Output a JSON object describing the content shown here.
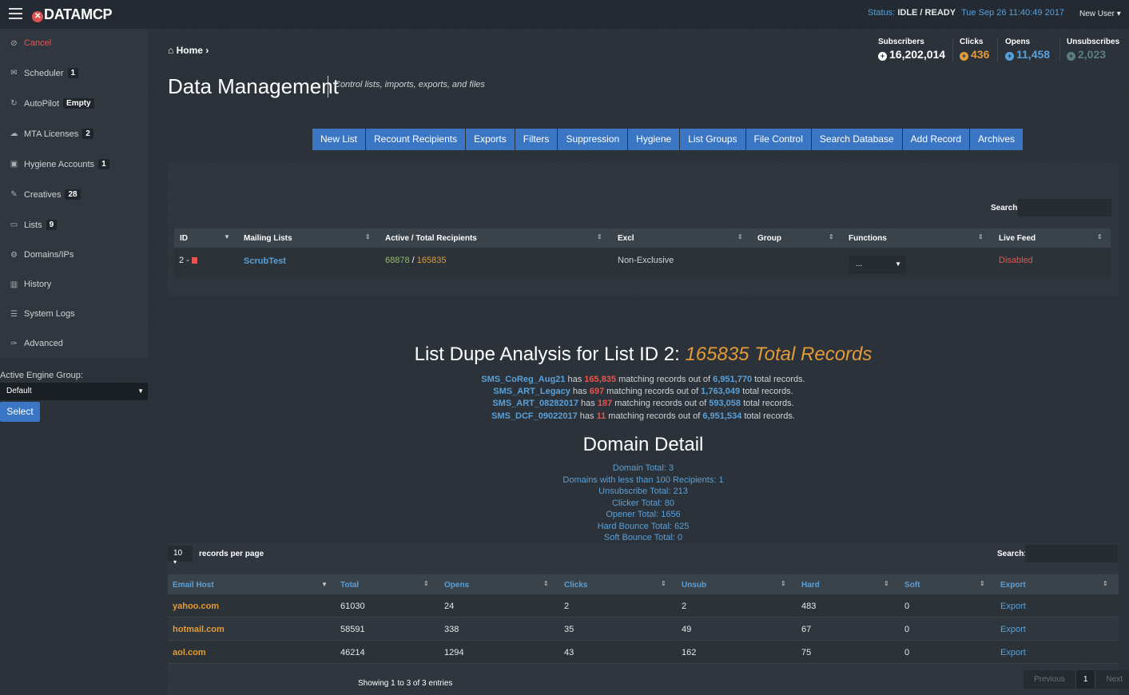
{
  "app": {
    "logo_prefix": "DATA",
    "logo_suffix": "MCP",
    "status_label": "Status:",
    "status_value": "IDLE / READY",
    "datetime": "Tue Sep 26 11:40:49 2017",
    "user_menu": "New User"
  },
  "sidebar": {
    "items": [
      {
        "label": "Cancel",
        "icon": "ban-icon",
        "badge": ""
      },
      {
        "label": "Scheduler",
        "icon": "envelope-icon",
        "badge": "1"
      },
      {
        "label": "AutoPilot",
        "icon": "refresh-icon",
        "badge": "Empty"
      },
      {
        "label": "MTA Licenses",
        "icon": "cloud-icon",
        "badge": "2"
      },
      {
        "label": "Hygiene Accounts",
        "icon": "briefcase-icon",
        "badge": "1"
      },
      {
        "label": "Creatives",
        "icon": "edit-icon",
        "badge": "28"
      },
      {
        "label": "Lists",
        "icon": "folder-icon",
        "badge": "9"
      },
      {
        "label": "Domains/IPs",
        "icon": "cogs-icon",
        "badge": ""
      },
      {
        "label": "History",
        "icon": "chart-icon",
        "badge": ""
      },
      {
        "label": "System Logs",
        "icon": "list-icon",
        "badge": ""
      },
      {
        "label": "Advanced",
        "icon": "wrench-icon",
        "badge": ""
      }
    ],
    "engine_group_label": "Active Engine Group:",
    "engine_group_value": "Default",
    "select_button": "Select"
  },
  "breadcrumb": {
    "home": "Home"
  },
  "stats": {
    "subscribers": {
      "label": "Subscribers",
      "value": "16,202,014",
      "color": "#ffffff"
    },
    "clicks": {
      "label": "Clicks",
      "value": "436",
      "color": "#e39a37"
    },
    "opens": {
      "label": "Opens",
      "value": "11,458",
      "color": "#5aa0d8"
    },
    "unsubscribes": {
      "label": "Unsubscribes",
      "value": "2,023",
      "color": "#5a7f80"
    }
  },
  "page": {
    "title": "Data Management",
    "subtitle": "Control lists, imports, exports, and files"
  },
  "tabs": [
    "New List",
    "Recount Recipients",
    "Exports",
    "Filters",
    "Suppression",
    "Hygiene",
    "List Groups",
    "File Control",
    "Search Database",
    "Add Record",
    "Archives"
  ],
  "lists_table": {
    "search_label": "Search:",
    "headers": [
      "ID",
      "Mailing Lists",
      "Active / Total Recipients",
      "Excl",
      "Group",
      "Functions",
      "Live Feed"
    ],
    "rows": [
      {
        "id": "2 -",
        "name": "ScrubTest",
        "active": "68878",
        "sep": "/",
        "total": "165835",
        "excl": "Non-Exclusive",
        "group": "",
        "functions": "...",
        "live_feed": "Disabled"
      }
    ]
  },
  "dupe": {
    "title_prefix": "List Dupe Analysis for List ID 2:",
    "title_highlight": "165835 Total Records",
    "lines": [
      {
        "list": "SMS_CoReg_Aug21",
        "has": "has",
        "count": "165,835",
        "mid": "matching records out of",
        "total": "6,951,770",
        "end": "total records."
      },
      {
        "list": "SMS_ART_Legacy",
        "has": "has",
        "count": "697",
        "mid": "matching records out of",
        "total": "1,763,049",
        "end": "total records."
      },
      {
        "list": "SMS_ART_08282017",
        "has": "has",
        "count": "187",
        "mid": "matching records out of",
        "total": "593,058",
        "end": "total records."
      },
      {
        "list": "SMS_DCF_09022017",
        "has": "has",
        "count": "11",
        "mid": "matching records out of",
        "total": "6,951,534",
        "end": "total records."
      }
    ]
  },
  "domain_detail": {
    "title": "Domain Detail",
    "lines": [
      "Domain Total: 3",
      "Domains with less than 100 Recipients: 1",
      "Unsubscribe Total: 213",
      "Clicker Total: 80",
      "Opener Total: 1656",
      "Hard Bounce Total: 625",
      "Soft Bounce Total: 0"
    ]
  },
  "domain_table": {
    "per_page": "10",
    "per_page_label": "records per page",
    "search_label": "Search:",
    "headers": [
      "Email Host",
      "Total",
      "Opens",
      "Clicks",
      "Unsub",
      "Hard",
      "Soft",
      "Export"
    ],
    "rows": [
      [
        "yahoo.com",
        "61030",
        "24",
        "2",
        "2",
        "483",
        "0",
        "Export"
      ],
      [
        "hotmail.com",
        "58591",
        "338",
        "35",
        "49",
        "67",
        "0",
        "Export"
      ],
      [
        "aol.com",
        "46214",
        "1294",
        "43",
        "162",
        "75",
        "0",
        "Export"
      ]
    ],
    "showing": "Showing 1 to 3 of 3 entries",
    "pager": {
      "prev": "Previous",
      "current": "1",
      "next": "Next"
    }
  }
}
